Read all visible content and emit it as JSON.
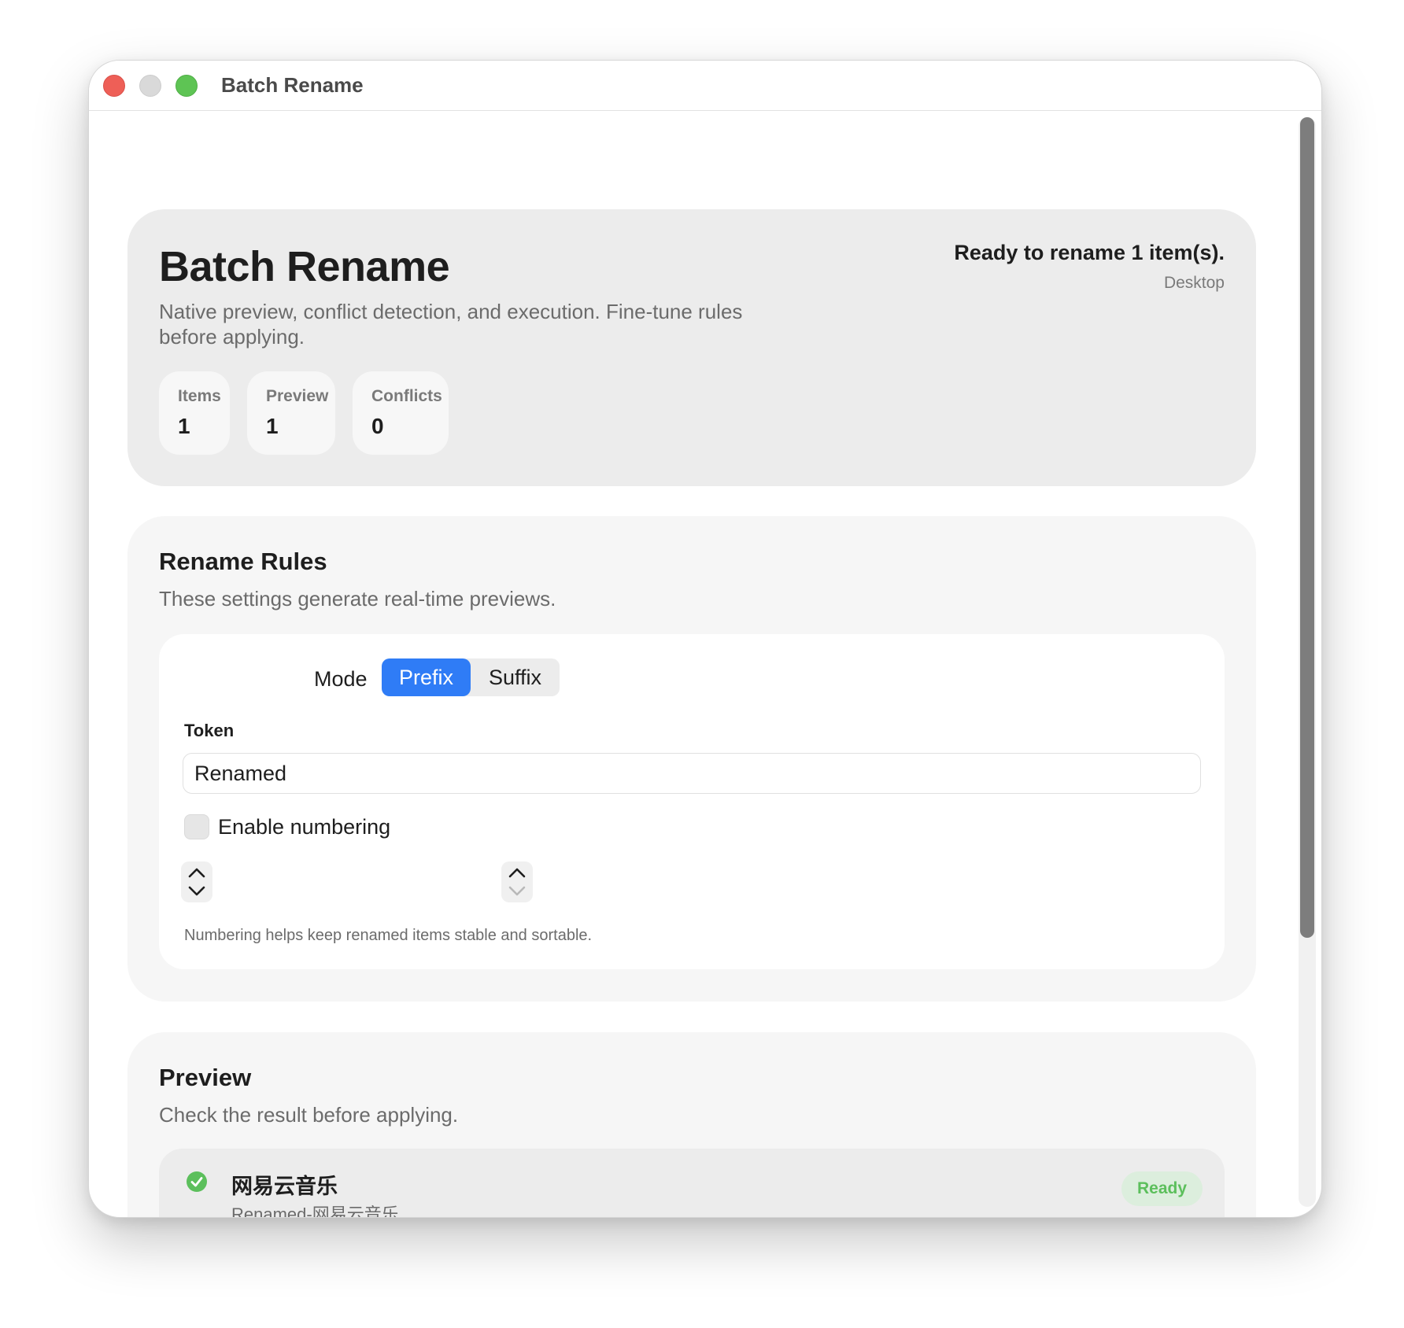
{
  "window": {
    "title": "Batch Rename"
  },
  "header": {
    "title": "Batch Rename",
    "subtitle": "Native preview, conflict detection, and execution. Fine-tune rules before applying.",
    "status": "Ready to rename 1 item(s).",
    "location": "Desktop",
    "stats": [
      {
        "label": "Items",
        "value": "1"
      },
      {
        "label": "Preview",
        "value": "1"
      },
      {
        "label": "Conflicts",
        "value": "0"
      }
    ]
  },
  "rules": {
    "title": "Rename Rules",
    "subtitle": "These settings generate real-time previews.",
    "mode_label": "Mode",
    "modes": [
      {
        "label": "Prefix",
        "selected": true
      },
      {
        "label": "Suffix",
        "selected": false
      }
    ],
    "token_label": "Token",
    "token_value": "Renamed",
    "numbering_label": "Enable numbering",
    "numbering_enabled": false,
    "help_text": "Numbering helps keep renamed items stable and sortable."
  },
  "preview": {
    "title": "Preview",
    "subtitle": "Check the result before applying.",
    "items": [
      {
        "original": "网易云音乐",
        "renamed": "Renamed-网易云音乐",
        "status": "Ready"
      }
    ]
  },
  "colors": {
    "accent": "#2f7cf6",
    "success": "#5cbf5c",
    "success_bg": "#dceedd",
    "card_bg": "#ececec"
  },
  "icons": {
    "traffic_lights": [
      "close-icon",
      "minimize-icon",
      "maximize-icon"
    ],
    "stepper": [
      "chevron-up-icon",
      "chevron-down-icon"
    ],
    "status": "checkmark-circle-icon"
  }
}
